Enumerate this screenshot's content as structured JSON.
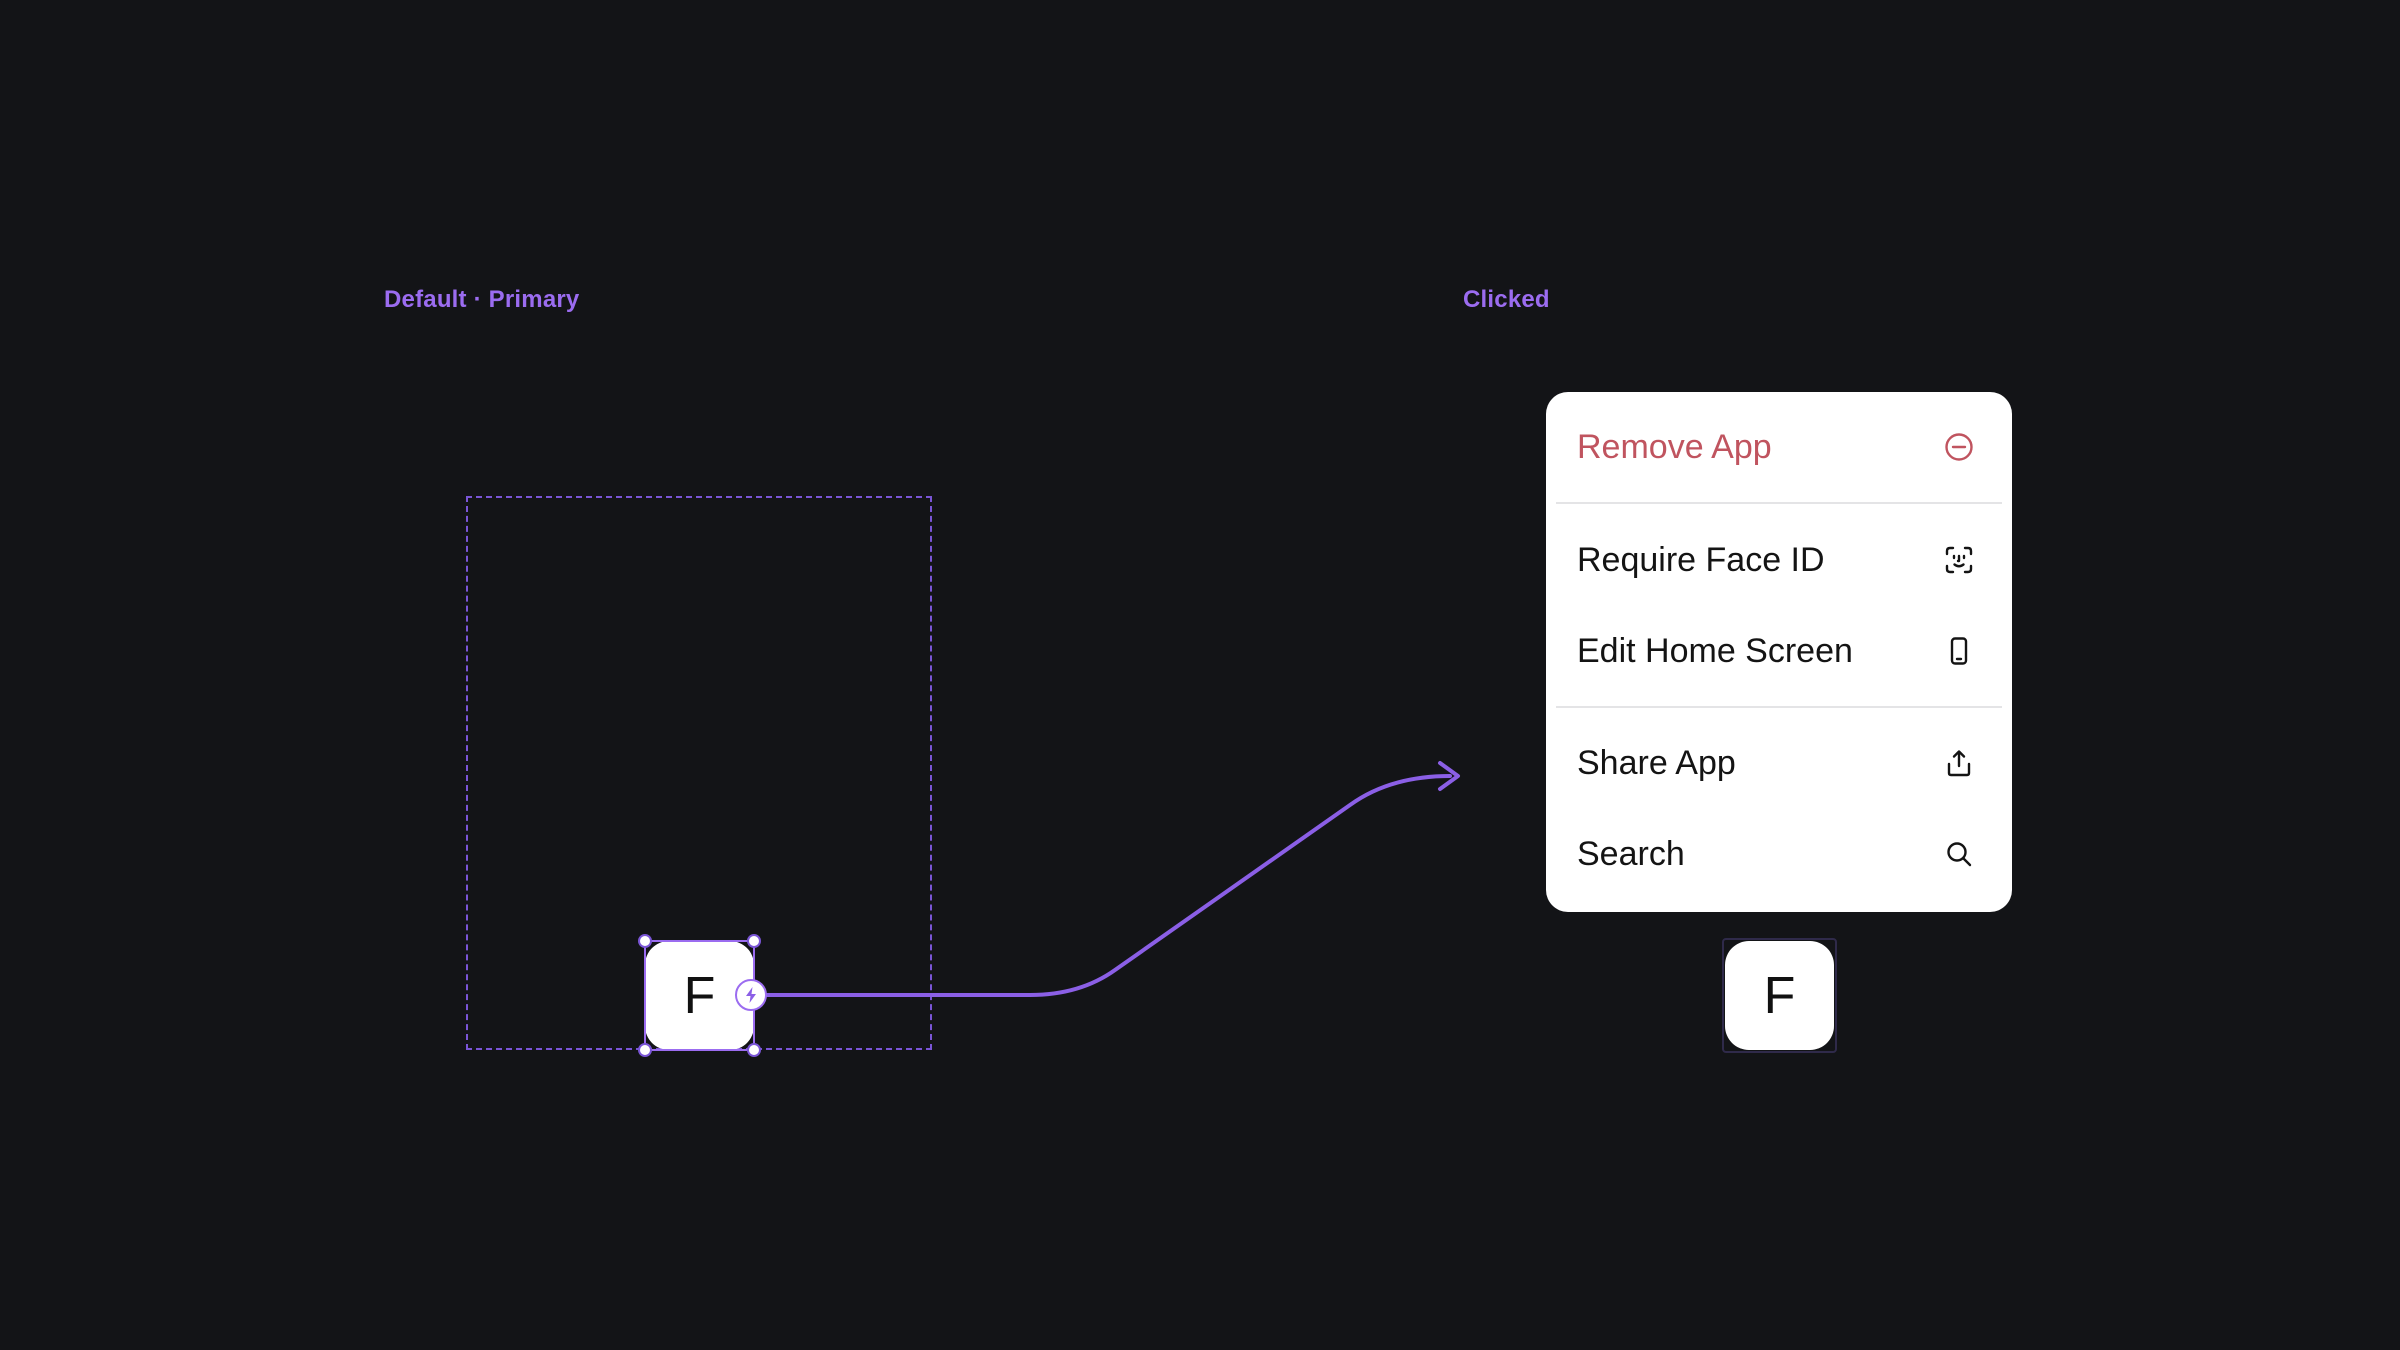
{
  "labels": {
    "default_state": "Default · Primary",
    "clicked_state": "Clicked"
  },
  "app_icon": {
    "letter": "F"
  },
  "context_menu": {
    "items": [
      {
        "label": "Remove App",
        "icon": "minus-circle-icon",
        "destructive": true
      },
      {
        "label": "Require Face ID",
        "icon": "face-id-icon",
        "destructive": false
      },
      {
        "label": "Edit Home Screen",
        "icon": "phone-icon",
        "destructive": false
      },
      {
        "label": "Share App",
        "icon": "share-icon",
        "destructive": false
      },
      {
        "label": "Search",
        "icon": "search-icon",
        "destructive": false
      }
    ]
  },
  "colors": {
    "background": "#131417",
    "accent": "#9b6cf0",
    "destructive": "#c0545f",
    "menu_background": "#ffffff"
  }
}
